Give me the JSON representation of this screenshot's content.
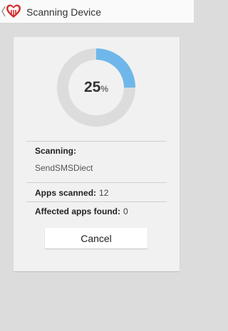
{
  "header": {
    "title": "Scanning Device",
    "logo_icon": "heart-heartbleed-logo-icon",
    "accent_color": "#d62a2a"
  },
  "progress": {
    "value": "25",
    "unit": "%",
    "fraction": 0.25,
    "fill_color": "#6fb7ea",
    "track_color": "#dcdcdc"
  },
  "scan": {
    "scanning_label": "Scanning:",
    "current_app": "SendSMSDiect",
    "apps_scanned_label": "Apps scanned:",
    "apps_scanned_value": "12",
    "affected_label": "Affected apps found:",
    "affected_value": "0"
  },
  "actions": {
    "cancel_label": "Cancel"
  }
}
